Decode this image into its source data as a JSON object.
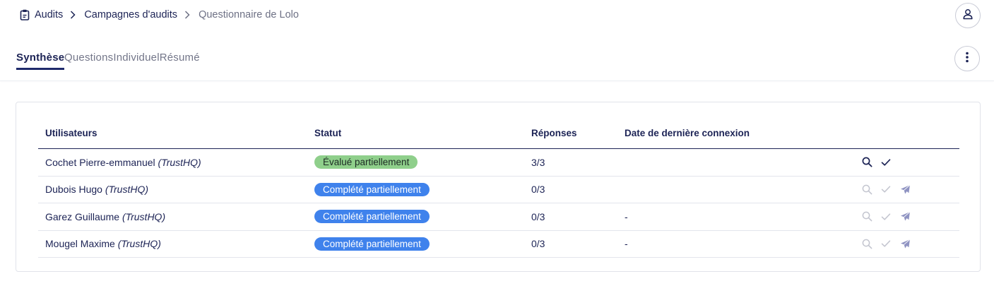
{
  "breadcrumb": {
    "items": [
      "Audits",
      "Campagnes d'audits"
    ],
    "current": "Questionnaire de Lolo"
  },
  "icons": {
    "breadcrumb": "clipboard-icon",
    "separator": "chevron-right-icon",
    "user": "user-icon",
    "more": "more-vertical-icon",
    "search": "search-icon",
    "validate": "check-icon",
    "send": "send-icon"
  },
  "tabs": [
    {
      "label": "Synthèse",
      "active": true
    },
    {
      "label": "Questions",
      "active": false
    },
    {
      "label": "Individuel",
      "active": false
    },
    {
      "label": "Résumé",
      "active": false
    }
  ],
  "table": {
    "headers": {
      "user": "Utilisateurs",
      "status": "Statut",
      "responses": "Réponses",
      "last_login": "Date de dernière connexion"
    },
    "rows": [
      {
        "name": "Cochet Pierre-emmanuel",
        "org": "(TrustHQ)",
        "status": "Évalué partiellement",
        "status_color": "green",
        "responses": "3/3",
        "last_login": "",
        "actions_enabled": true,
        "send_visible": false
      },
      {
        "name": "Dubois Hugo",
        "org": "(TrustHQ)",
        "status": "Complété partiellement",
        "status_color": "blue",
        "responses": "0/3",
        "last_login": "",
        "actions_enabled": false,
        "send_visible": true
      },
      {
        "name": "Garez Guillaume",
        "org": "(TrustHQ)",
        "status": "Complété partiellement",
        "status_color": "blue",
        "responses": "0/3",
        "last_login": "-",
        "actions_enabled": false,
        "send_visible": true
      },
      {
        "name": "Mougel Maxime",
        "org": "(TrustHQ)",
        "status": "Complété partiellement",
        "status_color": "blue",
        "responses": "0/3",
        "last_login": "-",
        "actions_enabled": false,
        "send_visible": true
      }
    ]
  },
  "colors": {
    "primary": "#1c2355",
    "badge_green": "#8fcf8b",
    "badge_blue": "#3f82ec",
    "disabled_icon": "#c3c5cf",
    "send_icon": "#8f93c2"
  }
}
